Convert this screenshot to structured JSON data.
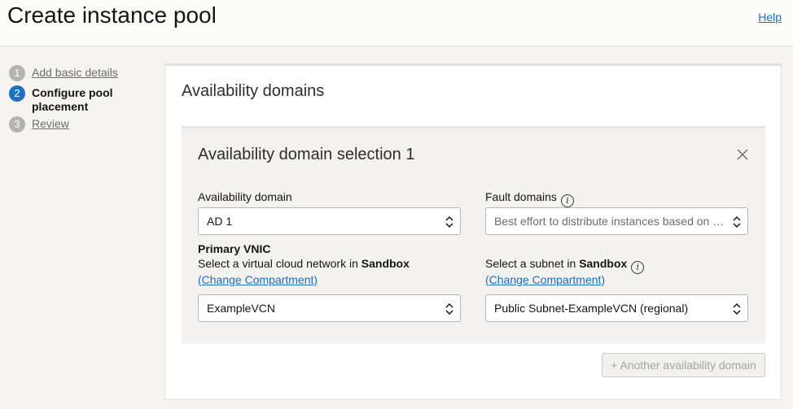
{
  "header": {
    "title": "Create instance pool",
    "help": "Help"
  },
  "steps": [
    {
      "number": "1",
      "label": "Add basic details"
    },
    {
      "number": "2",
      "label": "Configure pool placement"
    },
    {
      "number": "3",
      "label": "Review"
    }
  ],
  "panel": {
    "title": "Availability domains",
    "card": {
      "title": "Availability domain selection 1",
      "availability_domain": {
        "label": "Availability domain",
        "value": "AD 1"
      },
      "fault_domains": {
        "label": "Fault domains",
        "placeholder": "Best effort to distribute instances based on …"
      },
      "primary_vnic": {
        "heading": "Primary VNIC",
        "vcn_label_prefix": "Select a virtual cloud network in ",
        "vcn_compartment": "Sandbox",
        "vcn_change": "(Change Compartment)",
        "vcn_value": "ExampleVCN",
        "subnet_label_prefix": "Select a subnet in ",
        "subnet_compartment": "Sandbox",
        "subnet_change": "(Change Compartment)",
        "subnet_value": "Public Subnet-ExampleVCN (regional)"
      }
    },
    "add_button": "+ Another availability domain"
  }
}
